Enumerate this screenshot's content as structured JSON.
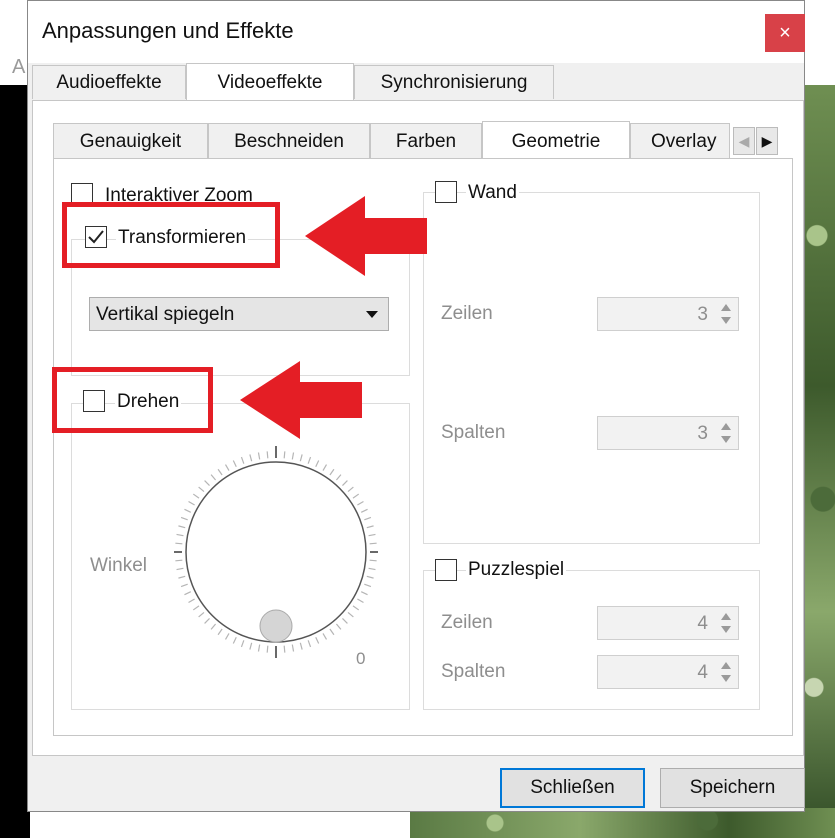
{
  "window": {
    "title": "Anpassungen und Effekte",
    "close_glyph": "×",
    "background_letter": "A"
  },
  "main_tabs": [
    {
      "label": "Audioeffekte",
      "active": false
    },
    {
      "label": "Videoeffekte",
      "active": true
    },
    {
      "label": "Synchronisierung",
      "active": false
    }
  ],
  "sub_tabs": [
    {
      "label": "Genauigkeit",
      "active": false
    },
    {
      "label": "Beschneiden",
      "active": false
    },
    {
      "label": "Farben",
      "active": false
    },
    {
      "label": "Geometrie",
      "active": true
    },
    {
      "label": "Overlay",
      "active": false
    }
  ],
  "tab_scroll": {
    "left_glyph": "◀",
    "right_glyph": "▶"
  },
  "geometry": {
    "interactive_zoom": {
      "label": "Interaktiver Zoom",
      "checked": false
    },
    "transform": {
      "label": "Transformieren",
      "checked": true,
      "selected_option": "Vertikal spiegeln"
    },
    "rotate": {
      "label": "Drehen",
      "checked": false,
      "angle_label": "Winkel",
      "angle_value": "0"
    },
    "wall": {
      "label": "Wand",
      "checked": false,
      "rows_label": "Zeilen",
      "rows_value": "3",
      "cols_label": "Spalten",
      "cols_value": "3"
    },
    "puzzle": {
      "label": "Puzzlespiel",
      "checked": false,
      "rows_label": "Zeilen",
      "rows_value": "4",
      "cols_label": "Spalten",
      "cols_value": "4"
    }
  },
  "buttons": {
    "close": "Schließen",
    "save": "Speichern"
  },
  "annotation_color": "#e41e25",
  "accent_color": "#0078d7"
}
